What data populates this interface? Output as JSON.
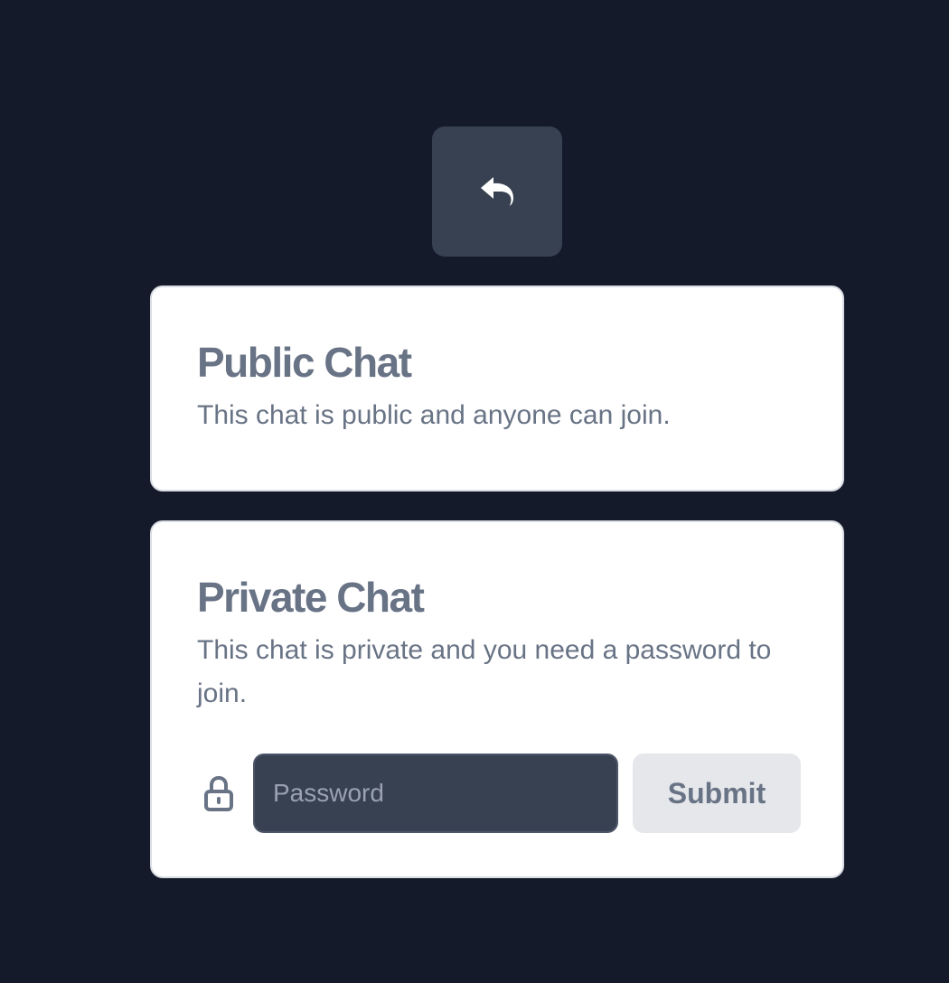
{
  "back_button": {
    "icon": "reply-arrow-icon"
  },
  "public_chat": {
    "title": "Public Chat",
    "description": "This chat is public and anyone can join."
  },
  "private_chat": {
    "title": "Private Chat",
    "description": "This chat is private and you need a password to join.",
    "lock_icon": "lock-icon",
    "password_placeholder": "Password",
    "password_value": "",
    "submit_label": "Submit"
  },
  "colors": {
    "background": "#141a29",
    "back_button": "#384152",
    "card": "#ffffff",
    "text": "#687385",
    "input": "#384152",
    "submit": "#e6e7eb"
  }
}
